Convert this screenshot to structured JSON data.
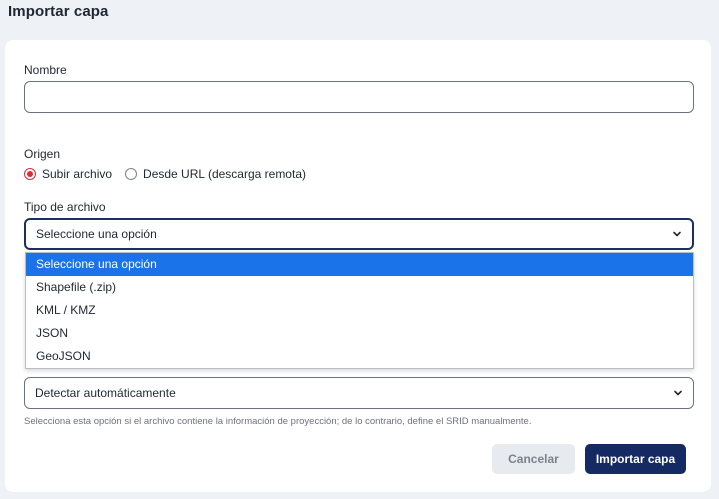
{
  "page": {
    "title": "Importar capa"
  },
  "form": {
    "name": {
      "label": "Nombre",
      "value": "",
      "placeholder": ""
    },
    "origin": {
      "label": "Origen",
      "options": [
        "Subir archivo",
        "Desde URL (descarga remota)"
      ],
      "selected": "Subir archivo"
    },
    "file_type": {
      "label": "Tipo de archivo",
      "selected": "Seleccione una opción",
      "options": [
        "Seleccione una opción",
        "Shapefile (.zip)",
        "KML / KMZ",
        "JSON",
        "GeoJSON"
      ],
      "highlighted": "Seleccione una opción"
    },
    "projection": {
      "selected": "Detectar automáticamente",
      "hint": "Selecciona esta opción si el archivo contiene la información de proyección; de lo contrario, define el SRID manualmente."
    }
  },
  "buttons": {
    "cancel": "Cancelar",
    "submit": "Importar capa"
  },
  "colors": {
    "primary": "#152a63",
    "radio_accent": "#d92d3a",
    "option_highlight": "#1a73e8",
    "page_background": "#eef1f5"
  },
  "icons": {
    "select_arrow": "chevron-down-icon"
  }
}
